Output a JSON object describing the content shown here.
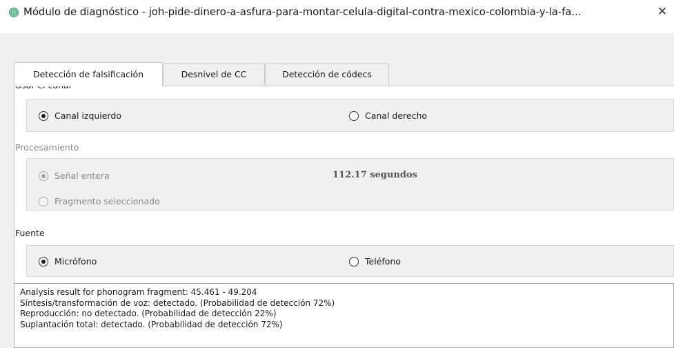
{
  "window": {
    "title": "Módulo de diagnóstico - joh-pide-dinero-a-asfura-para-montar-celula-digital-contra-mexico-colombia-y-la-fa...",
    "close_glyph": "✕",
    "icon": "app-gear-icon"
  },
  "tabs": [
    {
      "label": "Detección de falsificación",
      "active": true
    },
    {
      "label": "Desnivel de CC",
      "active": false
    },
    {
      "label": "Detección de códecs",
      "active": false
    }
  ],
  "channel": {
    "label": "Usar el canal",
    "options": [
      {
        "label": "Canal izquierdo",
        "checked": true
      },
      {
        "label": "Canal derecho",
        "checked": false
      }
    ]
  },
  "processing": {
    "label": "Procesamiento",
    "enabled": false,
    "options": [
      {
        "label": "Señal entera",
        "checked": true
      },
      {
        "label": "Fragmento seleccionado",
        "checked": false
      }
    ],
    "duration": "112.17 segundos"
  },
  "source": {
    "label": "Fuente",
    "options": [
      {
        "label": "Micrófono",
        "checked": true
      },
      {
        "label": "Teléfono",
        "checked": false
      }
    ]
  },
  "results": {
    "lines": [
      "Analysis result for phonogram fragment: 45.461 - 49.204",
      "Síntesis/transformación de voz:  detectado. (Probabilidad de detección 72%)",
      "Reproducción:  no detectado. (Probabilidad de detección 22%)",
      "Suplantación total:  detectado. (Probabilidad de detección 72%)"
    ]
  }
}
